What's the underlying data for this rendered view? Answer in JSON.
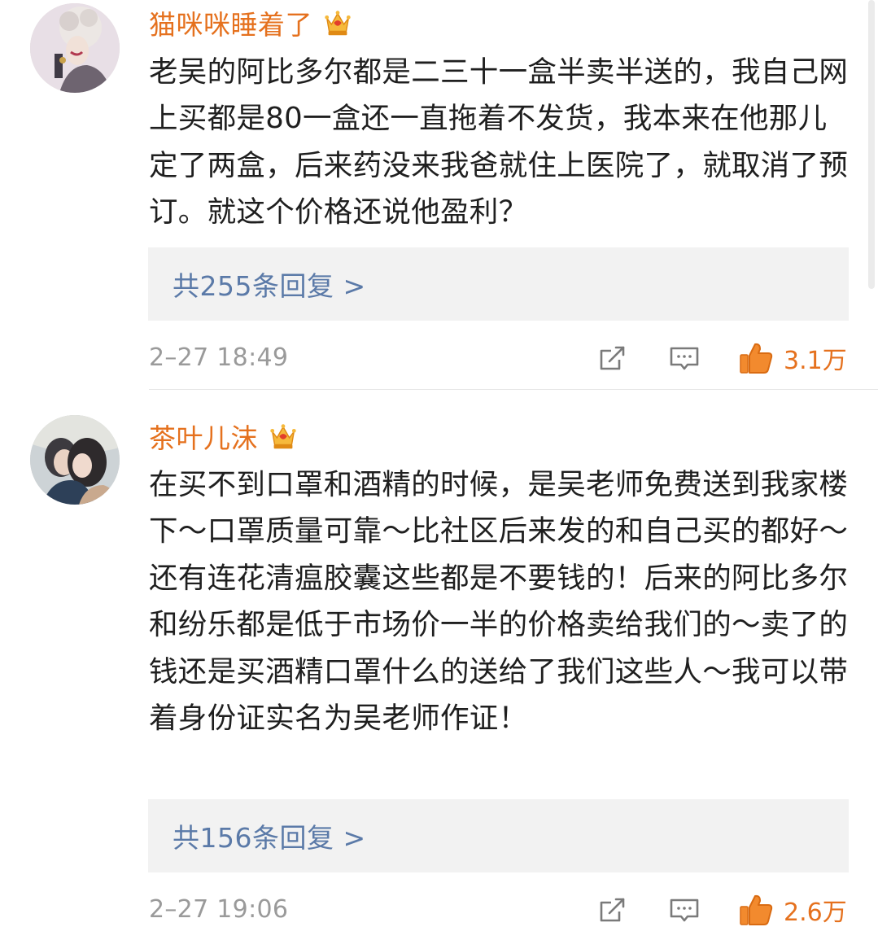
{
  "colors": {
    "username": "#e5711e",
    "reply_link": "#5b7aa8",
    "like_active": "#e5711e",
    "timestamp": "#9a9a9a"
  },
  "comments": [
    {
      "username": "猫咪咪睡着了",
      "badge_icon": "crown-icon",
      "content": "老吴的阿比多尔都是二三十一盒半卖半送的，我自己网上买都是80一盒还一直拖着不发货，我本来在他那儿定了两盒，后来药没来我爸就住上医院了，就取消了预订。就这个价格还说他盈利？",
      "replies_label": "共255条回复 >",
      "timestamp": "2–27 18:49",
      "likes": "3.1万"
    },
    {
      "username": "茶叶儿沫",
      "badge_icon": "crown-icon",
      "content": "在买不到口罩和酒精的时候，是吴老师免费送到我家楼下～口罩质量可靠～比社区后来发的和自己买的都好～还有连花清瘟胶囊这些都是不要钱的！后来的阿比多尔和纷乐都是低于市场价一半的价格卖给我们的～卖了的钱还是买酒精口罩什么的送给了我们这些人～我可以带着身份证实名为吴老师作证！",
      "replies_label": "共156条回复 >",
      "timestamp": "2–27 19:06",
      "likes": "2.6万"
    }
  ]
}
